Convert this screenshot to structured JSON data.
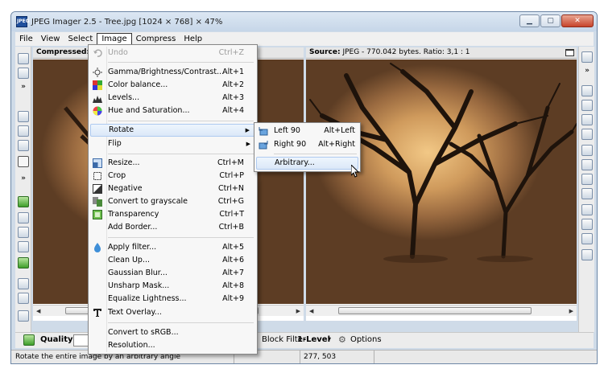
{
  "window": {
    "title": "JPEG Imager 2.5 - Tree.jpg [1024 × 768] × 47%",
    "app_icon_text": "JPEG"
  },
  "window_buttons": {
    "minimize": "▁",
    "maximize": "▢",
    "close": "✕"
  },
  "menubar": [
    {
      "label": "File"
    },
    {
      "label": "View"
    },
    {
      "label": "Select"
    },
    {
      "label": "Image",
      "active": true
    },
    {
      "label": "Compress"
    },
    {
      "label": "Help"
    }
  ],
  "left_pane": {
    "title": "Compressed:"
  },
  "right_pane": {
    "title": "Source:",
    "info": "JPEG - 770.042 bytes. Ratio: 3,1 : 1"
  },
  "image_menu": [
    {
      "type": "item",
      "label": "Undo",
      "shortcut": "Ctrl+Z",
      "disabled": true,
      "icon": "undo-icon"
    },
    {
      "type": "sep"
    },
    {
      "type": "item",
      "label": "Gamma/Brightness/Contrast...",
      "shortcut": "Alt+1",
      "icon": "brightness-icon"
    },
    {
      "type": "item",
      "label": "Color balance...",
      "shortcut": "Alt+2",
      "icon": "color-balance-icon"
    },
    {
      "type": "item",
      "label": "Levels...",
      "shortcut": "Alt+3",
      "icon": "levels-icon"
    },
    {
      "type": "item",
      "label": "Hue and Saturation...",
      "shortcut": "Alt+4",
      "icon": "hue-saturation-icon"
    },
    {
      "type": "sep"
    },
    {
      "type": "item",
      "label": "Rotate",
      "submenu": true,
      "highlighted": true
    },
    {
      "type": "item",
      "label": "Flip",
      "submenu": true
    },
    {
      "type": "sep"
    },
    {
      "type": "item",
      "label": "Resize...",
      "shortcut": "Ctrl+M",
      "icon": "resize-icon"
    },
    {
      "type": "item",
      "label": "Crop",
      "shortcut": "Ctrl+P",
      "icon": "crop-icon"
    },
    {
      "type": "item",
      "label": "Negative",
      "shortcut": "Ctrl+N",
      "icon": "negative-icon"
    },
    {
      "type": "item",
      "label": "Convert to grayscale",
      "shortcut": "Ctrl+G",
      "icon": "grayscale-icon"
    },
    {
      "type": "item",
      "label": "Transparency",
      "shortcut": "Ctrl+T",
      "icon": "transparency-icon"
    },
    {
      "type": "item",
      "label": "Add Border...",
      "shortcut": "Ctrl+B",
      "icon": "border-icon"
    },
    {
      "type": "sep"
    },
    {
      "type": "item",
      "label": "Apply filter...",
      "shortcut": "Alt+5",
      "icon": "filter-icon"
    },
    {
      "type": "item",
      "label": "Clean Up...",
      "shortcut": "Alt+6"
    },
    {
      "type": "item",
      "label": "Gaussian Blur...",
      "shortcut": "Alt+7"
    },
    {
      "type": "item",
      "label": "Unsharp Mask...",
      "shortcut": "Alt+8"
    },
    {
      "type": "item",
      "label": "Equalize Lightness...",
      "shortcut": "Alt+9"
    },
    {
      "type": "item",
      "label": "Text Overlay...",
      "icon": "text-overlay-icon"
    },
    {
      "type": "sep"
    },
    {
      "type": "item",
      "label": "Convert to sRGB..."
    },
    {
      "type": "item",
      "label": "Resolution..."
    }
  ],
  "rotate_submenu": [
    {
      "label": "Left 90",
      "shortcut": "Alt+Left",
      "icon": "rotate-left-icon"
    },
    {
      "label": "Right 90",
      "shortcut": "Alt+Right",
      "icon": "rotate-right-icon"
    },
    {
      "label": "Arbitrary...",
      "highlighted": true
    }
  ],
  "bottom_toolbar": {
    "quality_label": "Quality",
    "block_filter_label": "Block Filter:",
    "block_filter_value": "1-Level",
    "options_label": "Options"
  },
  "status_bar": {
    "message": "Rotate the entire image by an arbitrary angle",
    "coords": "277, 503"
  },
  "colors": {
    "window_frame": "#cfdbe8",
    "menu_highlight": "#dbe8f8",
    "menu_bg": "#f7f7f7"
  }
}
